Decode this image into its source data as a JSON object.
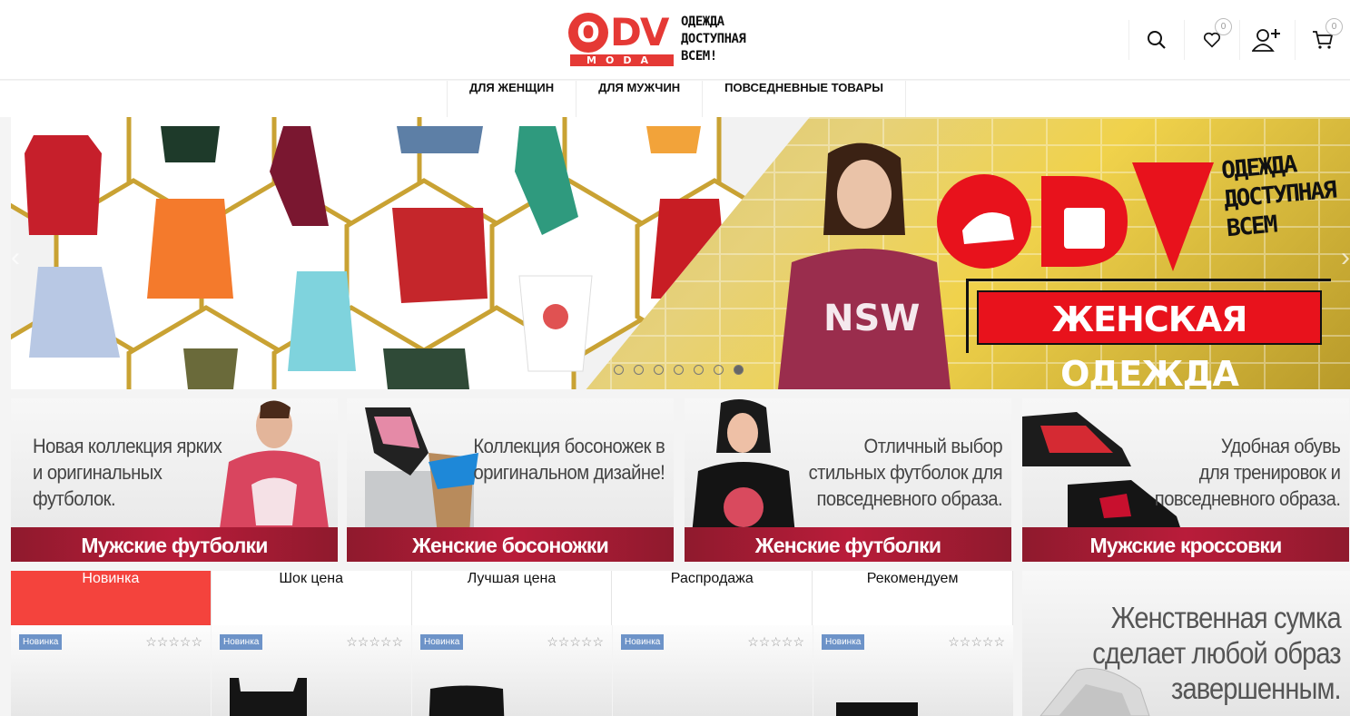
{
  "header": {
    "logo": {
      "letters": "ODV",
      "sub": "MODA",
      "slogan": [
        "ОДЕЖДА",
        "ДОСТУПНАЯ",
        "ВСЕМ!"
      ]
    },
    "wishlist_count": "0",
    "cart_count": "0",
    "icons": [
      "search-icon",
      "heart-icon",
      "user-add-icon",
      "cart-icon"
    ]
  },
  "nav": {
    "items": [
      "ДЛЯ ЖЕНЩИН",
      "ДЛЯ МУЖЧИН",
      "ПОВСЕДНЕВНЫЕ ТОВАРЫ"
    ]
  },
  "hero": {
    "slogan": [
      "ОДЕЖДА",
      "ДОСТУПНАЯ",
      "ВСЕМ"
    ],
    "cta": "ЖЕНСКАЯ ОДЕЖДА",
    "logo_letters": "ODV",
    "dots": 7,
    "active_dot": 7
  },
  "banners": [
    {
      "text": "Новая коллекция ярких\nи оригинальных\nфутболок.",
      "label": "Мужские футболки",
      "align": "left"
    },
    {
      "text": "Коллекция босоножек в\nоригинальном дизайне!",
      "label": "Женские босоножки",
      "align": "right"
    },
    {
      "text": "Отличный выбор\nстильных футболок для\nповседневного образа.",
      "label": "Женские футболки",
      "align": "right"
    },
    {
      "text": "Удобная обувь\nдля тренировок  и\nповседневного образа.",
      "label": "Мужские кроссовки",
      "align": "right"
    }
  ],
  "tabs": [
    "Новинка",
    "Шок цена",
    "Лучшая цена",
    "Распродажа",
    "Рекомендуем"
  ],
  "active_tab": 0,
  "products": [
    {
      "badge": "Новинка",
      "stars": "☆☆☆☆☆"
    },
    {
      "badge": "Новинка",
      "stars": "☆☆☆☆☆"
    },
    {
      "badge": "Новинка",
      "stars": "☆☆☆☆☆"
    },
    {
      "badge": "Новинка",
      "stars": "☆☆☆☆☆"
    },
    {
      "badge": "Новинка",
      "stars": "☆☆☆☆☆"
    }
  ],
  "side_banner": {
    "text": "Женственная сумка\nсделает любой образ\nзавершенным."
  },
  "colors": {
    "accent": "#f4433d",
    "brand_red": "#e53935",
    "banner_label": "#b91c3a",
    "badge": "#6d93c8"
  }
}
